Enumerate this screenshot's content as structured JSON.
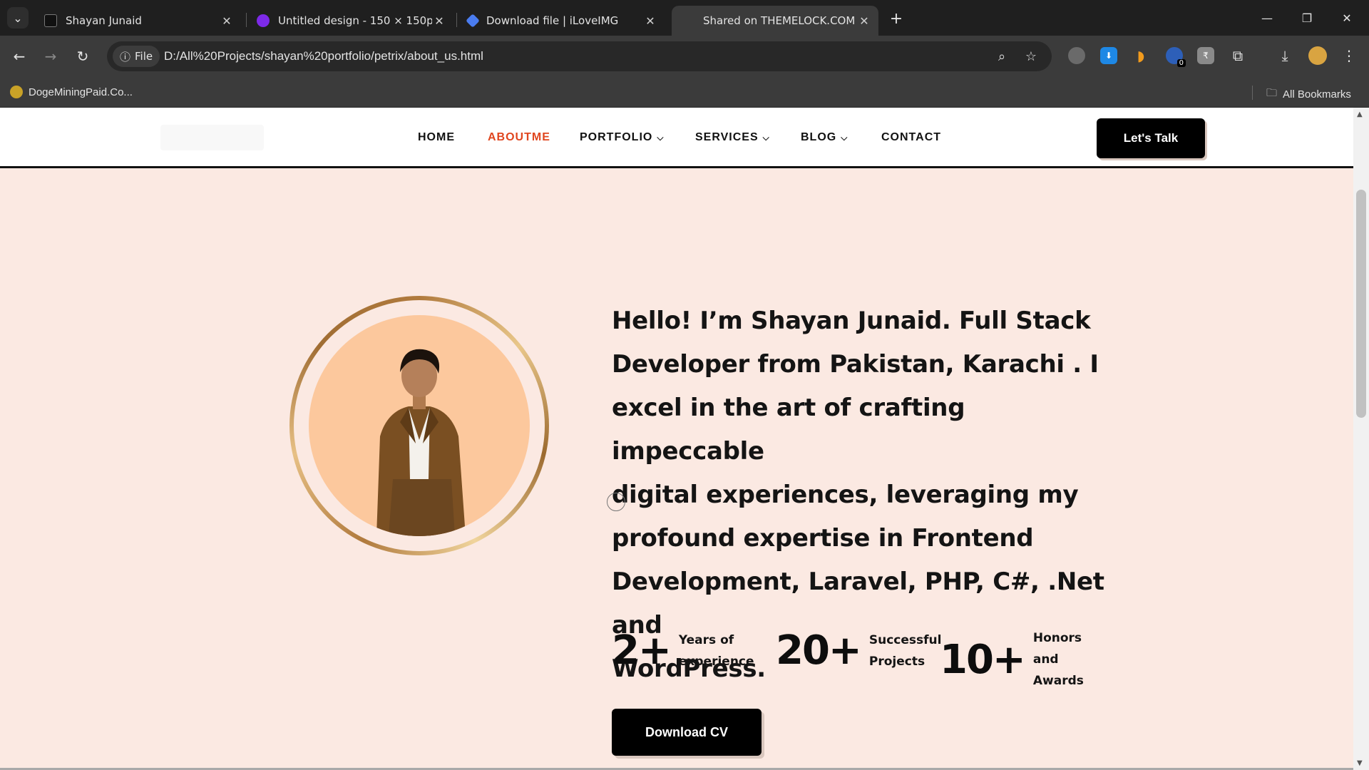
{
  "browser": {
    "tabs": [
      {
        "title": "Shayan Junaid",
        "favicon_color": "#111111",
        "active": false
      },
      {
        "title": "Untitled design - 150 × 150px",
        "favicon_color": "#7d2ae8",
        "active": false
      },
      {
        "title": "Download file | iLoveIMG",
        "favicon_color": "#4a7cf0",
        "active": false
      },
      {
        "title": "Shared on THEMELOCK.COM - ",
        "favicon_color": "",
        "active": true
      }
    ],
    "address": {
      "chip_label": "File",
      "url": "D:/All%20Projects/shayan%20portfolio/petrix/about_us.html"
    },
    "extension_badge": "0",
    "bookmarks": {
      "item": "DogeMiningPaid.Co...",
      "all": "All Bookmarks"
    }
  },
  "site": {
    "nav": {
      "home": "HOME",
      "about": "ABOUTME",
      "portfolio": "PORTFOLIO",
      "services": "SERVICES",
      "blog": "BLOG",
      "contact": "CONTACT",
      "active_color": "#e0461f"
    },
    "cta": "Let's Talk",
    "bio_lines": [
      "Hello! I’m Shayan Junaid. Full Stack",
      "Developer from Pakistan, Karachi . I",
      "excel in the art of crafting impeccable",
      "digital experiences, leveraging my",
      "profound expertise in Frontend",
      "Development, Laravel, PHP, C#, .Net and",
      "WordPress."
    ],
    "stats": [
      {
        "value": "2+",
        "label_lines": [
          "Years of",
          "experience"
        ]
      },
      {
        "value": "20+",
        "label_lines": [
          "Successful",
          "Projects"
        ]
      },
      {
        "value": "10+",
        "label_lines": [
          "Honors",
          "and",
          "Awards"
        ]
      }
    ],
    "download_cv": "Download CV",
    "background_color": "#fbe9e2"
  }
}
